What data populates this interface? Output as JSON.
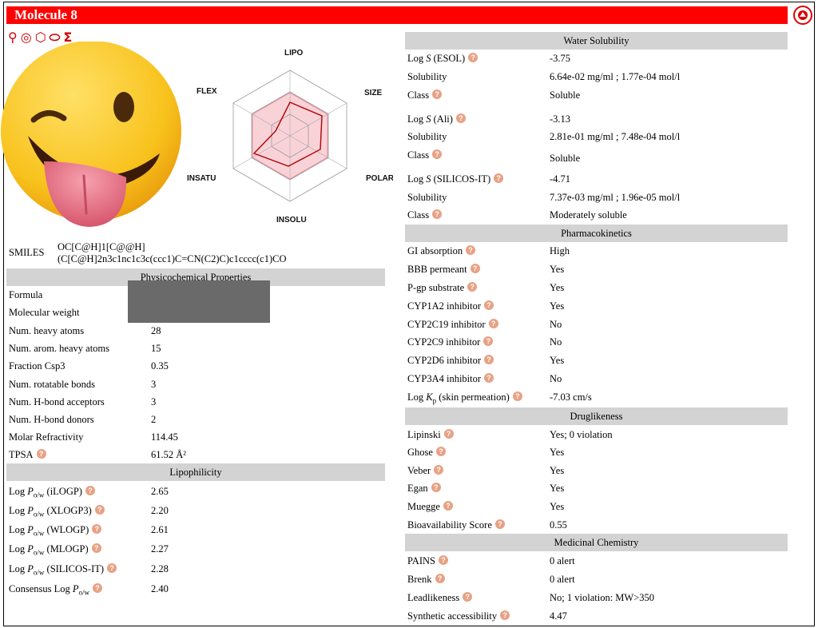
{
  "title": "Molecule 8",
  "tool_icons": [
    "molecule-icon",
    "target-icon",
    "hexagon-icon",
    "pill-icon",
    "sigma-icon"
  ],
  "radar": {
    "labels": [
      "LIPO",
      "SIZE",
      "POLAR",
      "INSOLU",
      "INSATU",
      "FLEX"
    ]
  },
  "smiles": {
    "label": "SMILES",
    "line1": "OC[C@H]1[C@@H]",
    "line2": "(C[C@H]2n3c1nc1c3c(ccc1)C=CN(C2)C)c1cccc(c1)CO"
  },
  "physchem": {
    "header": "Physicochemical Properties",
    "rows": [
      {
        "k": "Formula",
        "v": ""
      },
      {
        "k": "Molecular weight",
        "v": ""
      },
      {
        "k": "Num. heavy atoms",
        "v": "28"
      },
      {
        "k": "Num. arom. heavy atoms",
        "v": "15"
      },
      {
        "k": "Fraction Csp3",
        "v": "0.35"
      },
      {
        "k": "Num. rotatable bonds",
        "v": "3"
      },
      {
        "k": "Num. H-bond acceptors",
        "v": "3"
      },
      {
        "k": "Num. H-bond donors",
        "v": "2"
      },
      {
        "k": "Molar Refractivity",
        "v": "114.45"
      },
      {
        "k": "TPSA",
        "v": "61.52 Å²"
      }
    ]
  },
  "lipo": {
    "header": "Lipophilicity",
    "rows": [
      {
        "k": "(iLOGP)",
        "v": "2.65"
      },
      {
        "k": "(XLOGP3)",
        "v": "2.20"
      },
      {
        "k": "(WLOGP)",
        "v": "2.61"
      },
      {
        "k": "(MLOGP)",
        "v": "2.27"
      },
      {
        "k": "(SILICOS-IT)",
        "v": "2.28"
      },
      {
        "k": "Consensus",
        "v": "2.40"
      }
    ]
  },
  "water": {
    "header": "Water Solubility",
    "rows": [
      {
        "k": "(ESOL)",
        "v": "-3.75"
      },
      {
        "k": "Solubility",
        "v": "6.64e-02 mg/ml ; 1.77e-04 mol/l"
      },
      {
        "k": "Class",
        "v": "Soluble"
      },
      {
        "k": "(Ali)",
        "v": "-3.13"
      },
      {
        "k": "Solubility",
        "v": "2.81e-01 mg/ml ; 7.48e-04 mol/l"
      },
      {
        "k": "Class",
        "v": "Soluble"
      },
      {
        "k": "(SILICOS-IT)",
        "v": "-4.71"
      },
      {
        "k": "Solubility",
        "v": "7.37e-03 mg/ml ; 1.96e-05 mol/l"
      },
      {
        "k": "Class",
        "v": "Moderately soluble"
      }
    ]
  },
  "pk": {
    "header": "Pharmacokinetics",
    "rows": [
      {
        "k": "GI absorption",
        "v": "High"
      },
      {
        "k": "BBB permeant",
        "v": "Yes"
      },
      {
        "k": "P-gp substrate",
        "v": "Yes"
      },
      {
        "k": "CYP1A2 inhibitor",
        "v": "Yes"
      },
      {
        "k": "CYP2C19 inhibitor",
        "v": "No"
      },
      {
        "k": "CYP2C9 inhibitor",
        "v": "No"
      },
      {
        "k": "CYP2D6 inhibitor",
        "v": "Yes"
      },
      {
        "k": "CYP3A4 inhibitor",
        "v": "No"
      },
      {
        "k": "(skin permeation)",
        "v": "-7.03 cm/s"
      }
    ]
  },
  "drug": {
    "header": "Druglikeness",
    "rows": [
      {
        "k": "Lipinski",
        "v": "Yes; 0 violation"
      },
      {
        "k": "Ghose",
        "v": "Yes"
      },
      {
        "k": "Veber",
        "v": "Yes"
      },
      {
        "k": "Egan",
        "v": "Yes"
      },
      {
        "k": "Muegge",
        "v": "Yes"
      },
      {
        "k": "Bioavailability Score",
        "v": "0.55"
      }
    ]
  },
  "medchem": {
    "header": "Medicinal Chemistry",
    "rows": [
      {
        "k": "PAINS",
        "v": "0 alert"
      },
      {
        "k": "Brenk",
        "v": "0 alert"
      },
      {
        "k": "Leadlikeness",
        "v": "No; 1 violation: MW>350"
      },
      {
        "k": "Synthetic accessibility",
        "v": "4.47"
      }
    ]
  },
  "help_glyph": "?",
  "colors": {
    "title_bar": "#ff0000",
    "section_header": "#d3d3d3",
    "help_icon": "#e8a184",
    "radar_fill": "#f7c3cb",
    "radar_line": "#b00000"
  }
}
